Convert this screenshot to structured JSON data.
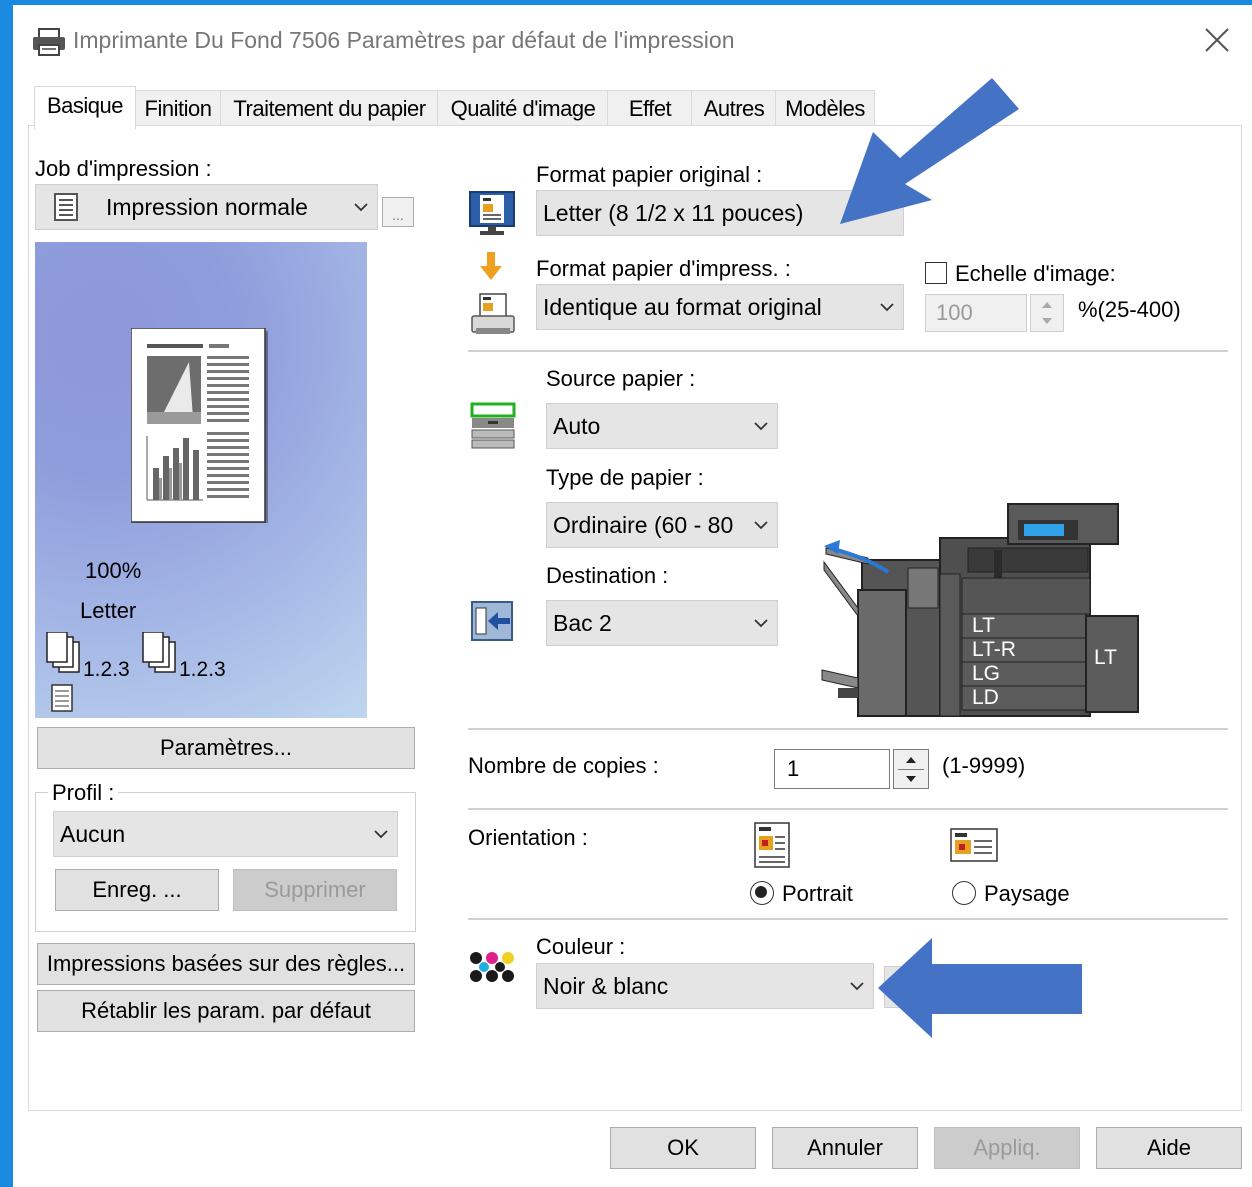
{
  "window": {
    "title": "Imprimante Du Fond 7506 Paramètres par défaut de l'impression"
  },
  "tabs": [
    "Basique",
    "Finition",
    "Traitement du papier",
    "Qualité d'image",
    "Effet",
    "Autres",
    "Modèles"
  ],
  "job": {
    "label": "Job d'impression :",
    "value": "Impression normale",
    "more_label": "..."
  },
  "preview": {
    "scale": "100%",
    "paper": "Letter",
    "collate_1": "1.2.3",
    "collate_2": "1.2.3"
  },
  "left_buttons": {
    "parametres": "Paramètres...",
    "regles": "Impressions basées sur des règles...",
    "retablir": "Rétablir les param. par défaut"
  },
  "profile": {
    "label": "Profil :",
    "value": "Aucun",
    "save": "Enreg. ...",
    "delete": "Supprimer"
  },
  "paper": {
    "original_label": "Format papier original :",
    "original_value": "Letter (8 1/2 x 11 pouces)",
    "print_label": "Format papier d'impress. :",
    "print_value": "Identique au format original",
    "scale_label": "Echelle d'image:",
    "scale_value": "100",
    "scale_range": "%(25-400)"
  },
  "source": {
    "label": "Source papier :",
    "value": "Auto",
    "type_label": "Type de papier :",
    "type_value": "Ordinaire (60 - 80",
    "dest_label": "Destination :",
    "dest_value": "Bac 2"
  },
  "printer_trays": [
    "LT",
    "LT-R",
    "LG",
    "LD"
  ],
  "printer_side_tray": "LT",
  "copies": {
    "label": "Nombre de copies :",
    "value": "1",
    "range": "(1-9999)"
  },
  "orientation": {
    "label": "Orientation :",
    "portrait": "Portrait",
    "landscape": "Paysage",
    "selected": "Portrait"
  },
  "color": {
    "label": "Couleur :",
    "value": "Noir & blanc"
  },
  "footer": {
    "ok": "OK",
    "cancel": "Annuler",
    "apply": "Appliq.",
    "help": "Aide"
  },
  "colors": {
    "accent": "#1a8ae0",
    "annotation_arrow": "#4472c4"
  }
}
